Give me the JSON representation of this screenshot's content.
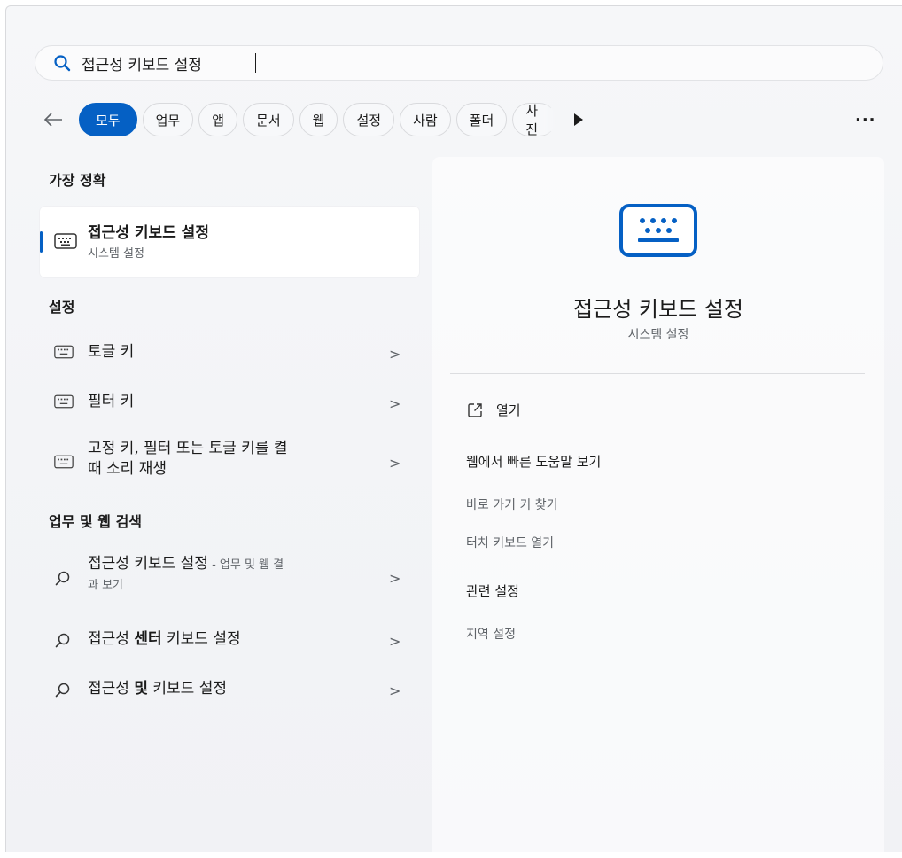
{
  "search": {
    "query": "접근성 키보드 설정",
    "placeholder": ""
  },
  "filters": {
    "chips": [
      "모두",
      "업무",
      "앱",
      "문서",
      "웹",
      "설정",
      "사람",
      "폴더",
      "사진"
    ],
    "more": "···"
  },
  "best_match": {
    "heading": "가장 정확",
    "title": "접근성 키보드 설정",
    "subtitle": "시스템 설정"
  },
  "settings": {
    "heading": "설정",
    "items": [
      {
        "label": "토글 키"
      },
      {
        "label": "필터 키"
      },
      {
        "label_line1": "고정 키, 필터 또는 토글 키를 켤",
        "label_line2": "때 소리 재생"
      }
    ]
  },
  "web": {
    "heading": "업무 및 웹 검색",
    "items": [
      {
        "label": "접근성 키보드 설정",
        "suffix": " - 업무 및 웹 결",
        "suffix2": "과 보기"
      },
      {
        "pre": "접근성 ",
        "bold": "센터",
        "post": " 키보드 설정"
      },
      {
        "pre": "접근성 ",
        "bold": "및",
        "post": " 키보드 설정"
      }
    ]
  },
  "chevron": ">",
  "detail": {
    "title": "접근성 키보드 설정",
    "subtitle": "시스템 설정",
    "open": "열기",
    "web_help": "웹에서 빠른 도움말 보기",
    "links": [
      "바로 가기 키 찾기",
      "터치 키보드 열기"
    ],
    "related_heading": "관련 설정",
    "related": [
      "지역 설정"
    ]
  },
  "colors": {
    "accent": "#0560c4",
    "muted": "#5f6368"
  }
}
